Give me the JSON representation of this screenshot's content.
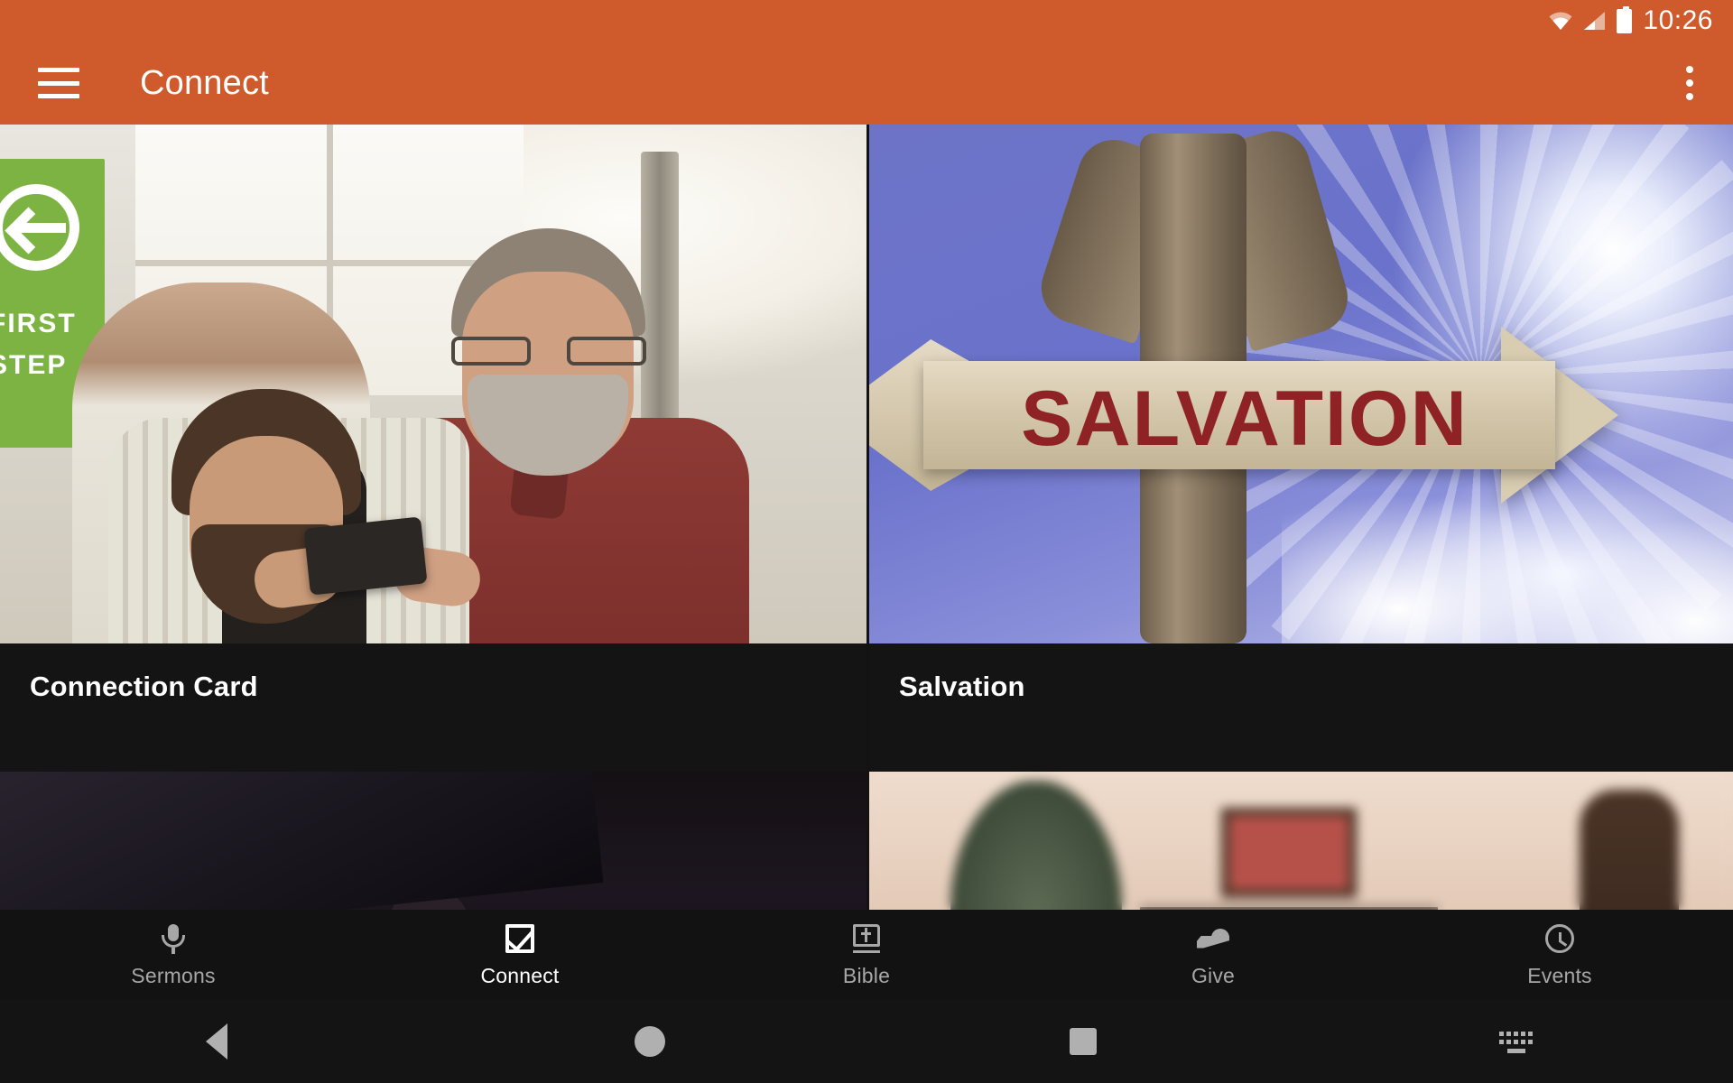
{
  "status_bar": {
    "time": "10:26",
    "icons": [
      "wifi-icon",
      "cell-signal-icon",
      "battery-icon"
    ]
  },
  "app_bar": {
    "menu_icon": "hamburger-menu-icon",
    "title": "Connect",
    "overflow_icon": "overflow-menu-icon"
  },
  "grid": {
    "rows": [
      {
        "cards": [
          {
            "title": "Connection Card",
            "image": "two-men-looking-at-phone-photo"
          },
          {
            "title": "Salvation",
            "image": "salvation-wooden-arrow-sign-photo"
          }
        ]
      },
      {
        "cards": [
          {
            "title": "",
            "image": "dark-stage-worship-photo"
          },
          {
            "title": "",
            "image": "christmas-living-room-photo"
          }
        ]
      }
    ]
  },
  "salvation_sign": {
    "text": "SALVATION"
  },
  "first_steps_banner": {
    "line1": "FIRST",
    "line2": "STEP"
  },
  "tab_bar": {
    "tabs": [
      {
        "label": "Sermons",
        "icon": "microphone-icon",
        "active": false
      },
      {
        "label": "Connect",
        "icon": "checkbox-checked-icon",
        "active": true
      },
      {
        "label": "Bible",
        "icon": "bible-book-icon",
        "active": false
      },
      {
        "label": "Give",
        "icon": "giving-hand-icon",
        "active": false
      },
      {
        "label": "Events",
        "icon": "clock-icon",
        "active": false
      }
    ]
  },
  "system_nav": {
    "buttons": [
      "back-icon",
      "home-icon",
      "recents-icon",
      "keyboard-icon"
    ]
  },
  "colors": {
    "accent": "#cf5a2b",
    "background": "#121212",
    "tab_active": "#ffffff",
    "tab_inactive": "#a7a7a7",
    "salvation_text": "#8e2225",
    "banner_green": "#7cb342"
  }
}
